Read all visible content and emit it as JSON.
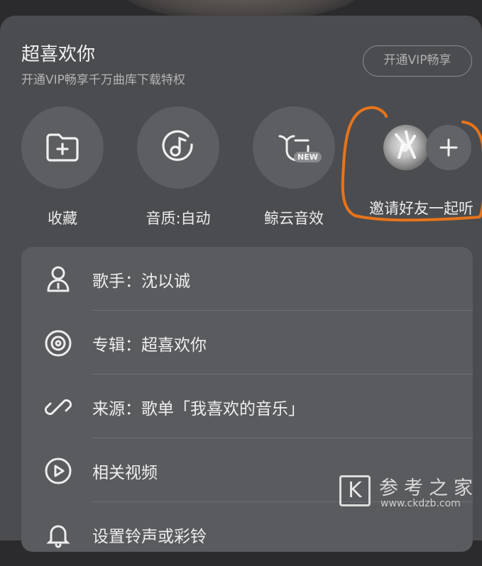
{
  "header": {
    "song_title": "超喜欢你",
    "subtitle": "开通VIP畅享千万曲库下载特权",
    "vip_button": "开通VIP畅享"
  },
  "actions": [
    {
      "label": "收藏",
      "icon": "folder-plus-icon"
    },
    {
      "label": "音质:自动",
      "icon": "music-note-icon"
    },
    {
      "label": "鲸云音效",
      "icon": "whale-icon",
      "badge": "NEW"
    }
  ],
  "invite": {
    "label": "邀请好友一起听",
    "avatar_icon": "friend-avatar",
    "plus_icon": "plus-icon"
  },
  "info": {
    "rows": [
      {
        "label": "歌手：沈以诚",
        "icon": "person-icon"
      },
      {
        "label": "专辑：超喜欢你",
        "icon": "album-disc-icon"
      },
      {
        "label": "来源：歌单「我喜欢的音乐」",
        "icon": "link-icon"
      },
      {
        "label": "相关视频",
        "icon": "play-video-icon"
      },
      {
        "label": "设置铃声或彩铃",
        "icon": "bell-icon"
      }
    ]
  },
  "watermark": {
    "logo_letter": "K",
    "name": "参考之家",
    "url": "www.ckdzb.com"
  },
  "colors": {
    "sheet": "#4b4c4f",
    "card": "#5a5b5e",
    "highlight": "#e8741a"
  }
}
